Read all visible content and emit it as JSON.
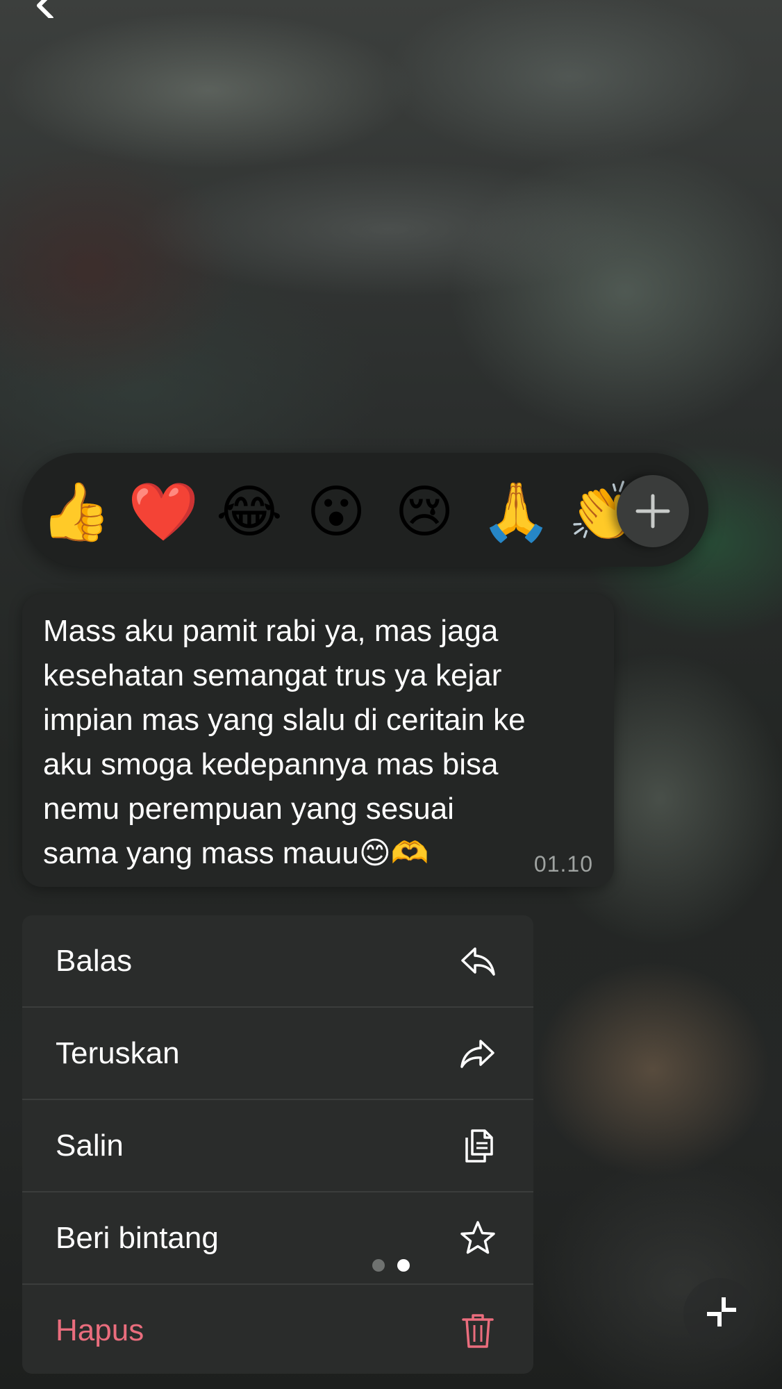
{
  "reactions": {
    "emojis": [
      "👍",
      "❤️",
      "😂",
      "😮",
      "😢",
      "🙏",
      "👏"
    ],
    "more_icon": "plus-icon"
  },
  "message": {
    "text": "Mass aku pamit rabi ya, mas jaga\nkesehatan semangat trus ya kejar\nimpian mas yang slalu di ceritain ke\naku smoga kedepannya mas bisa\nnemu perempuan yang sesuai\nsama yang mass mauu😊🫶",
    "time": "01.10"
  },
  "menu": {
    "items": [
      {
        "label": "Balas",
        "icon": "reply-icon"
      },
      {
        "label": "Teruskan",
        "icon": "forward-icon"
      },
      {
        "label": "Salin",
        "icon": "copy-icon"
      },
      {
        "label": "Beri bintang",
        "icon": "star-icon"
      },
      {
        "label": "Hapus",
        "icon": "trash-icon"
      }
    ],
    "danger_color": "#ea6d7d"
  },
  "pagination": {
    "pages": 2,
    "current": 2
  },
  "colors": {
    "bubble": "#242625",
    "menu": "#2a2c2b",
    "reaction_bar": "#1f2120"
  }
}
